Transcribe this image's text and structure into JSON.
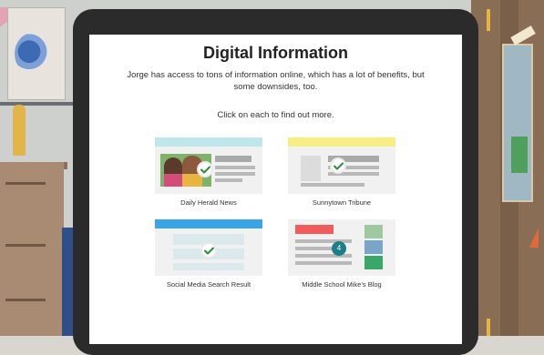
{
  "lesson": {
    "title": "Digital Information",
    "description": "Jorge has access to tons of information online, which has a lot of benefits, but some downsides, too.",
    "instruction": "Click on each to find out more."
  },
  "cards": [
    {
      "label": "Daily Herald News",
      "bar_color": "#bfe6ea",
      "checked": true
    },
    {
      "label": "Sunnytown Tribune",
      "bar_color": "#f7ee86",
      "checked": true
    },
    {
      "label": "Social Media Search Result",
      "bar_color": "#3aa4e8",
      "checked": true
    },
    {
      "label": "Middle School Mike’s Blog",
      "bar_color": "#f15b5b",
      "checked": false,
      "badge": "4"
    }
  ],
  "colors": {
    "check_green": "#2e8b3d",
    "tablet_frame": "#2b2b2c"
  }
}
